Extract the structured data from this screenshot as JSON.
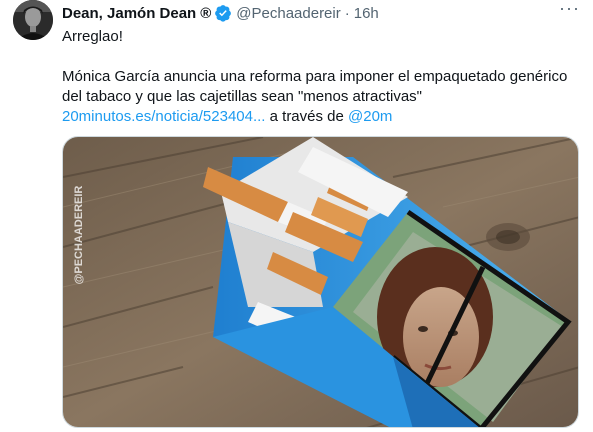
{
  "author": {
    "name": "Dean, Jamón Dean",
    "registered_mark": "®",
    "handle": "@Pechaadereir",
    "separator": "·",
    "time": "16h"
  },
  "more_label": "···",
  "tweet": {
    "line1": "Arreglao!",
    "line2": "Mónica García anuncia una reforma para imponer el empaquetado genérico del tabaco y que las cajetillas sean \"menos atractivas\"",
    "link_url_text": "20minutos.es/noticia/523404...",
    "via_text": " a través de ",
    "mention": "@20m"
  },
  "media": {
    "watermark": "@PECHAADEREIR"
  },
  "colors": {
    "text": "#0f1419",
    "secondary": "#536471",
    "link": "#1d9bf0",
    "verified": "#1d9bf0"
  },
  "icons": [
    "verified-badge-icon",
    "more-options-icon"
  ]
}
